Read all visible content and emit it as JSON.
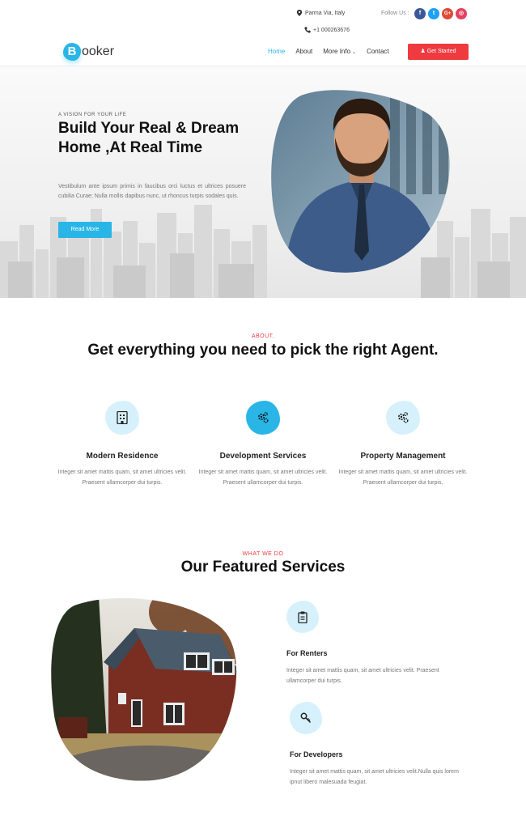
{
  "topbar": {
    "address": "Parma Via, Italy",
    "phone": "+1 000263676",
    "follow_label": "Follow Us :",
    "socials": [
      {
        "icon": "facebook-icon",
        "glyph": "f",
        "color": "#3b5998"
      },
      {
        "icon": "twitter-icon",
        "glyph": "t",
        "color": "#1da1f2"
      },
      {
        "icon": "google-plus-icon",
        "glyph": "G+",
        "color": "#dd4b39"
      },
      {
        "icon": "instagram-icon",
        "glyph": "◎",
        "color": "#e4405f"
      }
    ]
  },
  "nav": {
    "logo_letter": "B",
    "logo_rest": "ooker",
    "items": [
      "Home",
      "About",
      "More Info",
      "Contact"
    ],
    "active": "Home",
    "cta": "Get Started"
  },
  "hero": {
    "eyebrow": "A VISION FOR YOUR LIFE",
    "title": "Build Your Real & Dream Home ,At Real Time",
    "text": "Vestibulum ante ipsum primis in faucibus orci luctus et ultrices posuere cubilia Curae; Nulla mollis dapibus nunc, ut rhoncus turpis sodales quis.",
    "button": "Read More"
  },
  "about": {
    "eyebrow": "ABOUT.",
    "title": "Get everything you need to pick the right Agent.",
    "features": [
      {
        "title": "Modern Residence",
        "text": "Integer sit amet mattis quam, sit amet ultricies velit. Praesent ullamcorper dui turpis.",
        "icon": "building-icon",
        "highlight": false
      },
      {
        "title": "Development Services",
        "text": "Integer sit amet mattis quam, sit amet ultricies velit. Praesent ullamcorper dui turpis.",
        "icon": "gears-icon",
        "highlight": true
      },
      {
        "title": "Property Management",
        "text": "Integer sit amet mattis quam, sit amet ultricies velit. Praesent ullamcorper dui turpis.",
        "icon": "gears-icon",
        "highlight": false
      }
    ]
  },
  "services": {
    "eyebrow": "WHAT WE DO",
    "title": "Our Featured Services",
    "items": [
      {
        "title": "For Renters",
        "text": "Integer sit amet mattis quam, sit amet ultricies velit. Praesent ullamcorper dui turpis.",
        "icon": "clipboard-icon"
      },
      {
        "title": "For Developers",
        "text": "Integer sit amet mattis quam, sit amet ultricies velit.Nulla quis lorem ipnut libero malesuada feugiat.",
        "icon": "key-icon"
      }
    ]
  },
  "colors": {
    "accent": "#29b6e6",
    "cta": "#ef3a3f",
    "icon_bg": "#d6f1fb"
  }
}
